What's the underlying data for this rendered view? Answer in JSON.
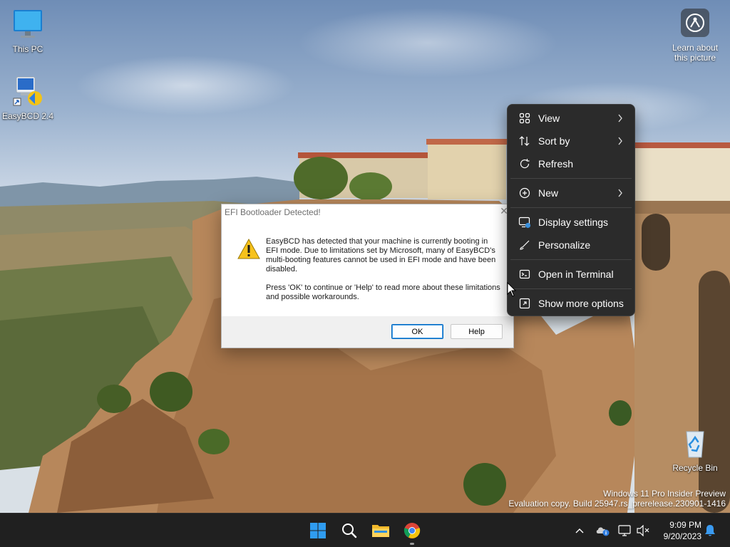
{
  "desktop": {
    "icons": [
      {
        "label": "This PC",
        "icon": "monitor-icon"
      },
      {
        "label": "EasyBCD 2.4",
        "icon": "easybcd-icon"
      },
      {
        "label": "Recycle Bin",
        "icon": "recycle-bin-icon"
      }
    ],
    "learn_label": "Learn about this picture"
  },
  "dialog": {
    "title": "EFI Bootloader Detected!",
    "message_1": "EasyBCD has detected that your machine is currently booting in EFI mode. Due to limitations set by Microsoft, many of EasyBCD's multi-booting features cannot be used in EFI mode and have been disabled.",
    "message_2": "Press 'OK' to continue or 'Help' to read more about these limitations and possible workarounds.",
    "ok_label": "OK",
    "help_label": "Help"
  },
  "context_menu": {
    "items": [
      {
        "label": "View",
        "icon": "grid-view-icon",
        "submenu": true
      },
      {
        "label": "Sort by",
        "icon": "sort-icon",
        "submenu": true
      },
      {
        "label": "Refresh",
        "icon": "refresh-icon",
        "submenu": false
      },
      {
        "label": "New",
        "icon": "plus-circle-icon",
        "submenu": true
      },
      {
        "label": "Display settings",
        "icon": "display-settings-icon",
        "submenu": false
      },
      {
        "label": "Personalize",
        "icon": "brush-icon",
        "submenu": false
      },
      {
        "label": "Open in Terminal",
        "icon": "terminal-icon",
        "submenu": false
      },
      {
        "label": "Show more options",
        "icon": "more-options-icon",
        "submenu": false
      }
    ]
  },
  "watermark": {
    "line1": "Windows 11 Pro Insider Preview",
    "line2": "Evaluation copy. Build 25947.rs_prerelease.230901-1416"
  },
  "taskbar": {
    "time": "9:09 PM",
    "date": "9/20/2023"
  },
  "colors": {
    "accent": "#0067c0",
    "menu_bg": "#2b2b2b",
    "taskbar_bg": "#202020",
    "warning": "#f7c21b"
  }
}
